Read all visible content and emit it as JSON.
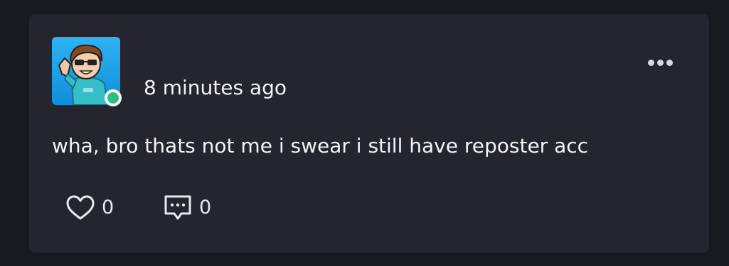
{
  "post": {
    "timestamp": "8 minutes ago",
    "body": "wha, bro thats not me i swear i still have reposter acc",
    "author_status": "online",
    "likes": "0",
    "comments": "0"
  },
  "icons": {
    "more": "more-options-icon",
    "like": "heart-icon",
    "comment": "comment-icon"
  },
  "colors": {
    "background": "#191920",
    "card": "#25252f",
    "online": "#2ebd85",
    "avatar_bg": "#1aa3e8"
  }
}
